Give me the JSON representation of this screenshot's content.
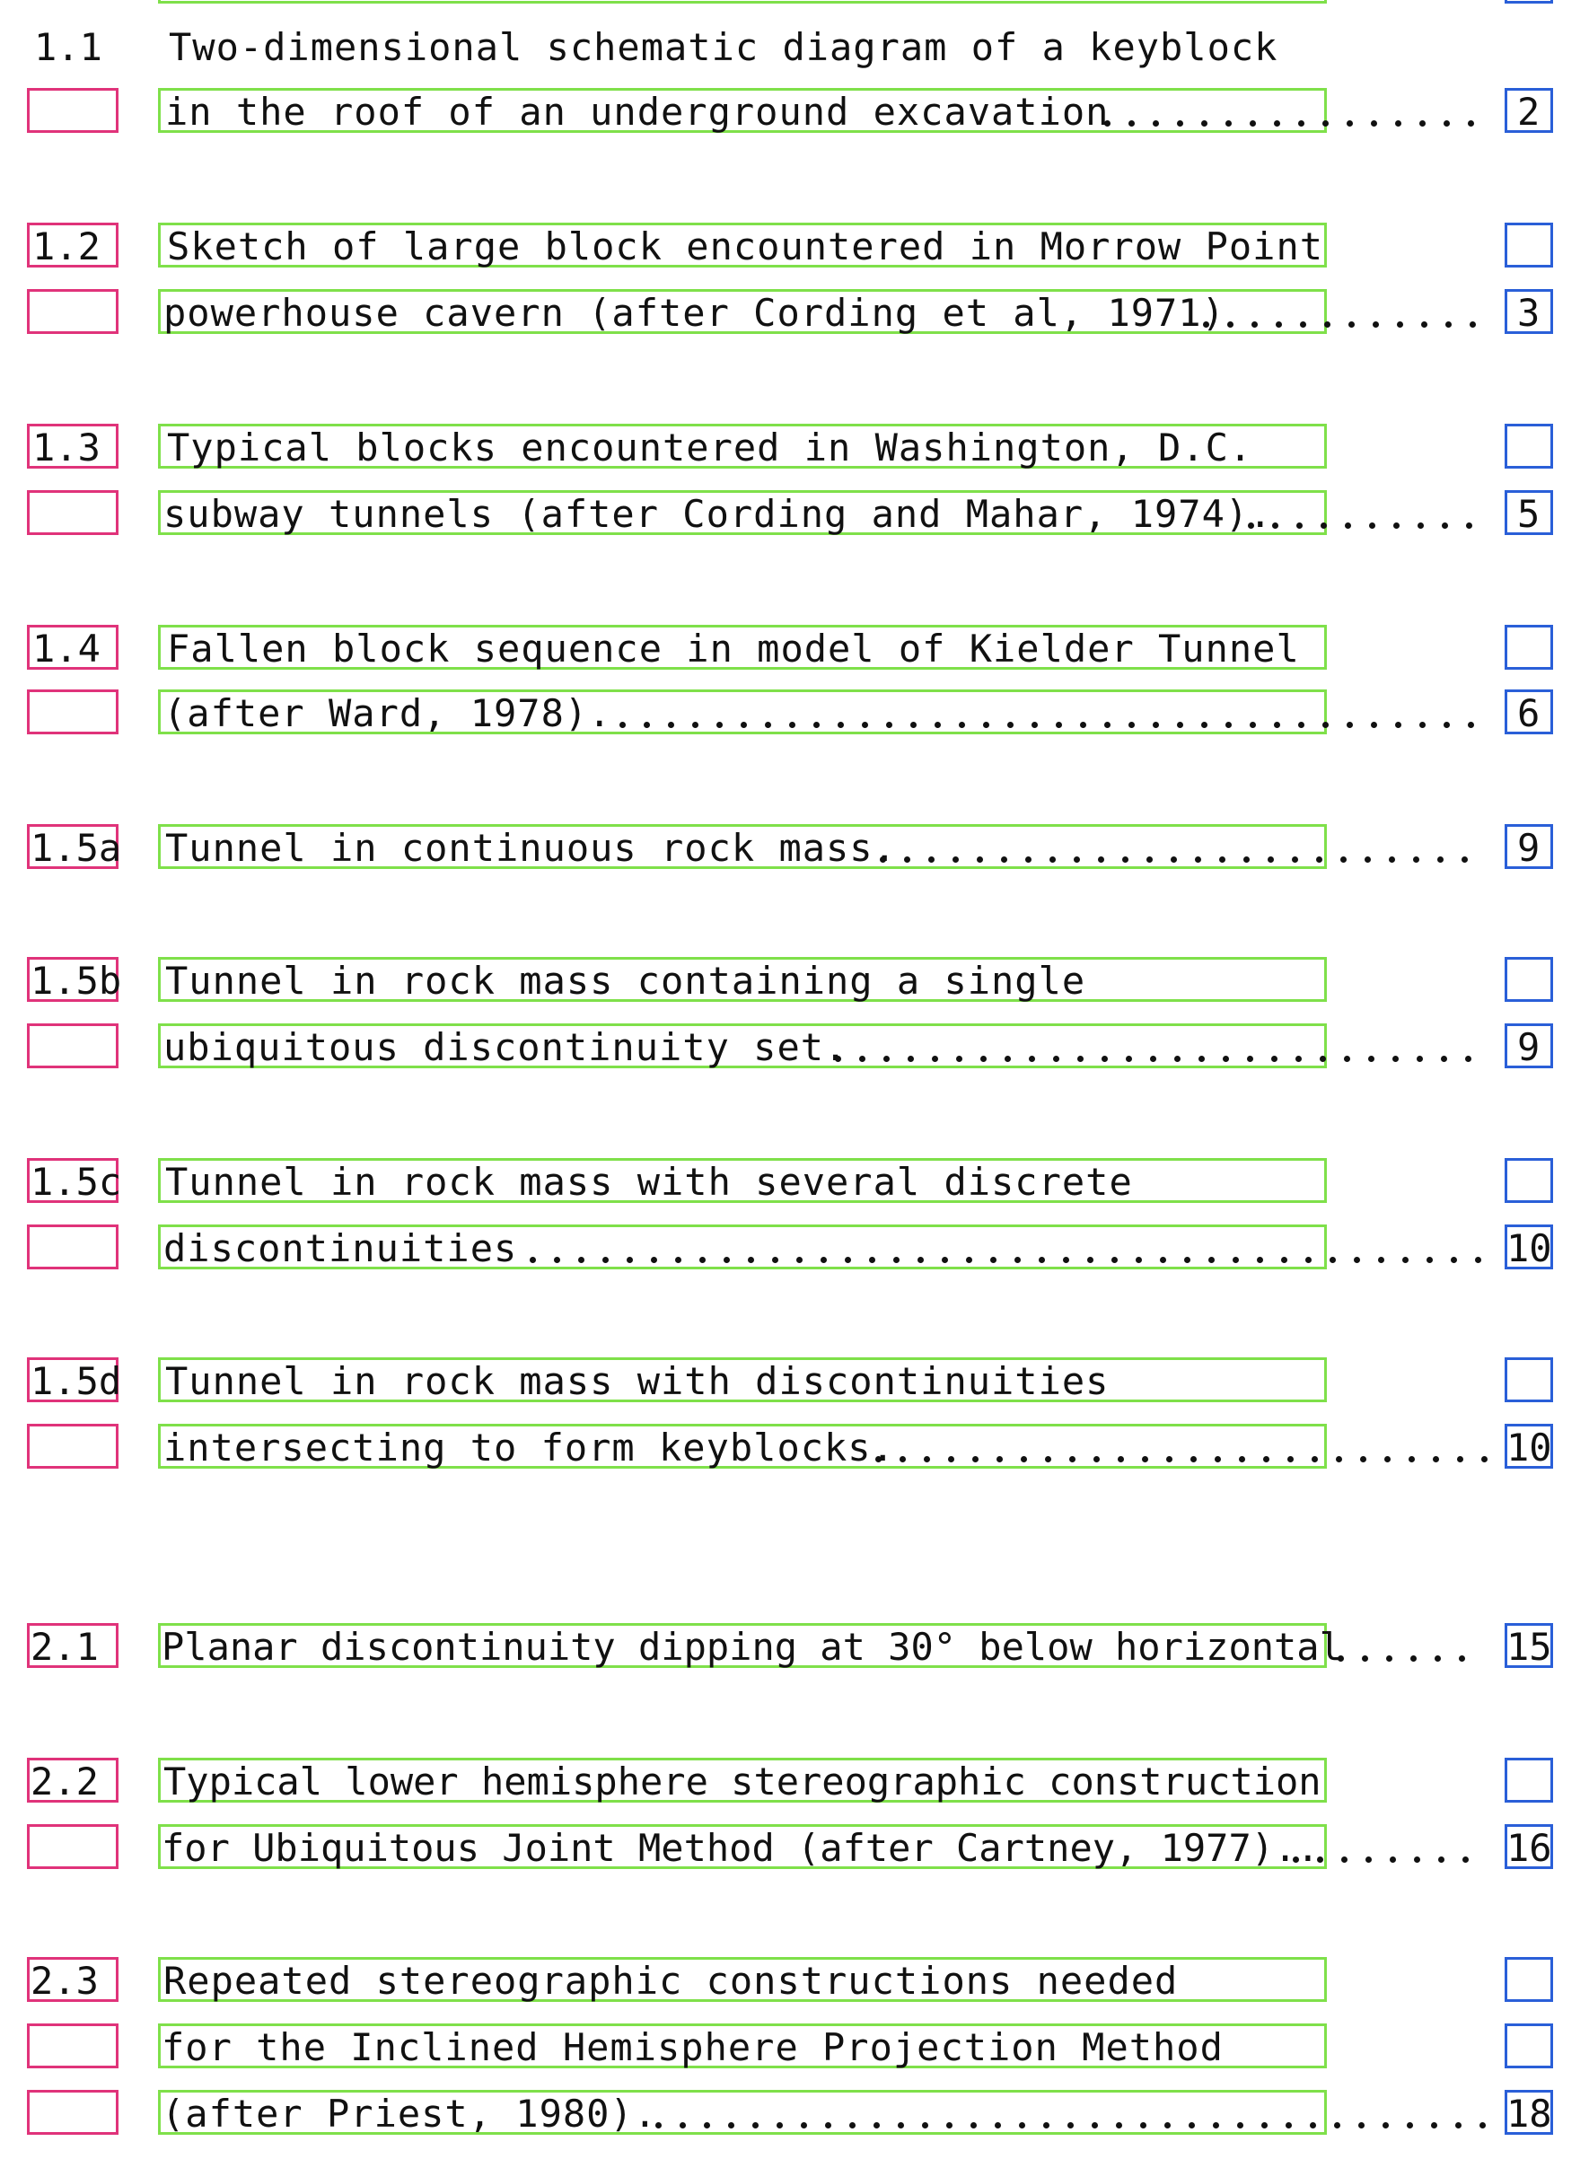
{
  "entries": [
    {
      "number": "1.1",
      "lines": [
        "Two-dimensional schematic diagram of a keyblock",
        "in the roof of an underground excavation"
      ],
      "page": "2"
    },
    {
      "number": "1.2",
      "lines": [
        "Sketch of large block encountered in Morrow Point",
        "powerhouse cavern (after Cording et al, 1971)"
      ],
      "page": "3"
    },
    {
      "number": "1.3",
      "lines": [
        "Typical blocks encountered in Washington, D.C.",
        "subway tunnels (after Cording and Mahar, 1974)."
      ],
      "page": "5"
    },
    {
      "number": "1.4",
      "lines": [
        "Fallen block sequence in model of Kielder Tunnel",
        "(after Ward, 1978)."
      ],
      "page": "6"
    },
    {
      "number": "1.5a",
      "lines": [
        "Tunnel in continuous rock mass."
      ],
      "page": "9"
    },
    {
      "number": "1.5b",
      "lines": [
        "Tunnel in rock mass containing a single",
        "ubiquitous discontinuity set."
      ],
      "page": "9"
    },
    {
      "number": "1.5c",
      "lines": [
        "Tunnel in rock mass with several discrete",
        "discontinuities"
      ],
      "page": "10"
    },
    {
      "number": "1.5d",
      "lines": [
        "Tunnel in rock mass with discontinuities",
        "intersecting to form keyblocks."
      ],
      "page": "10"
    },
    {
      "number": "2.1",
      "lines": [
        "Planar discontinuity dipping at 30° below horizontal"
      ],
      "page": "15"
    },
    {
      "number": "2.2",
      "lines": [
        "Typical lower hemisphere stereographic construction",
        "for Ubiquitous Joint Method (after Cartney, 1977).."
      ],
      "page": "16"
    },
    {
      "number": "2.3",
      "lines": [
        "Repeated stereographic constructions needed",
        "for the Inclined Hemisphere Projection Method",
        "(after Priest, 1980)."
      ],
      "page": "18"
    }
  ],
  "colors": {
    "number_box": "#e0337a",
    "text_box": "#7fe04a",
    "page_box": "#2a5fd8"
  }
}
